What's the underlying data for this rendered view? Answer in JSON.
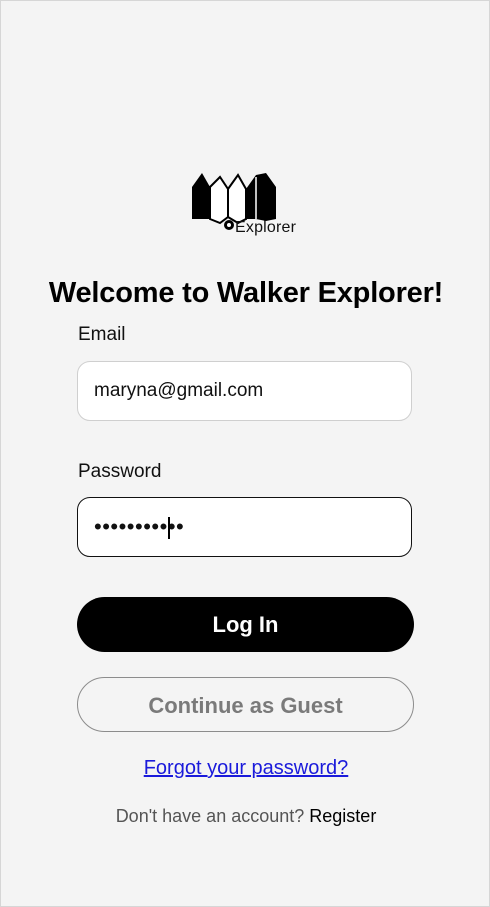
{
  "app": {
    "logo_text": "Explorer",
    "title": "Welcome to Walker Explorer!"
  },
  "form": {
    "email_label": "Email",
    "email_value": "maryna@gmail.com",
    "password_label": "Password",
    "password_value": "•••••••••••"
  },
  "actions": {
    "login_label": "Log In",
    "guest_label": "Continue as Guest",
    "forgot_label": "Forgot your password?",
    "register_prompt": "Don't have an account?",
    "register_label": "Register"
  },
  "colors": {
    "primary": "#000000",
    "background": "#f4f4f4",
    "link": "#1a1adb",
    "muted": "#7a7a7a"
  }
}
